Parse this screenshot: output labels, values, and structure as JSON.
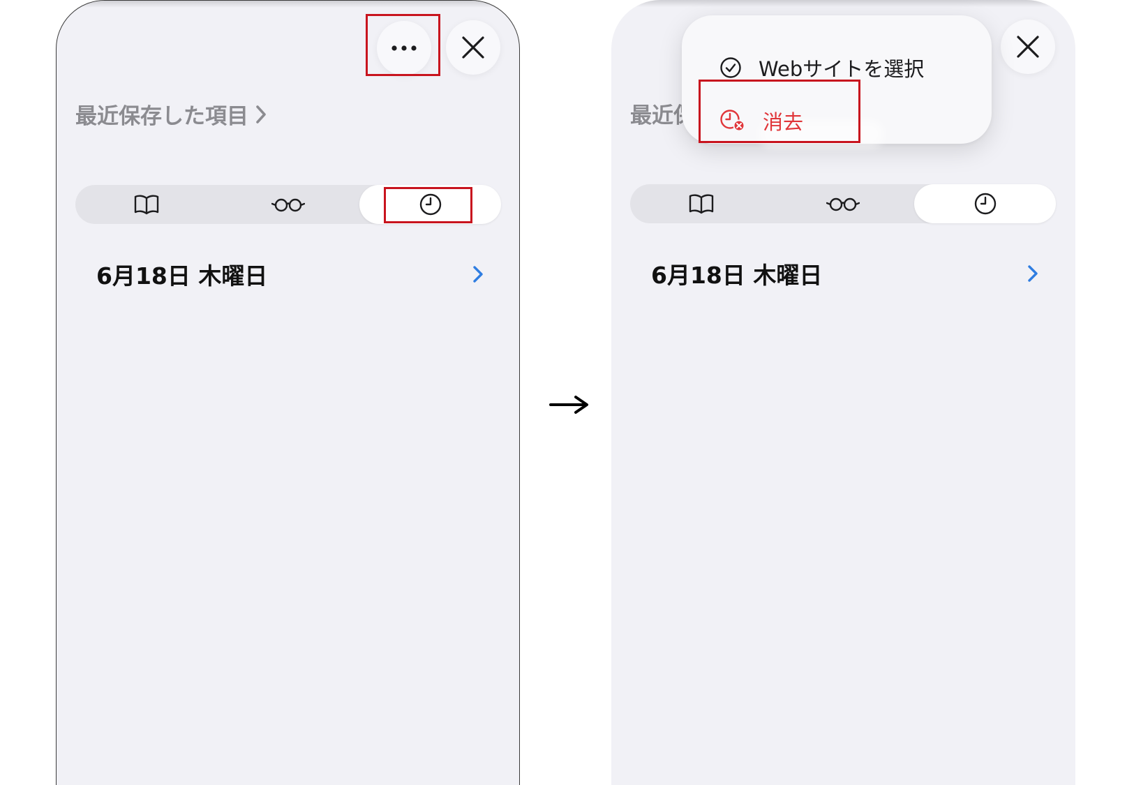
{
  "left": {
    "section_title": "最近保存した項目",
    "date_row": "6月18日 木曜日"
  },
  "right": {
    "section_title_partial": "最近保",
    "date_row": "6月18日 木曜日",
    "menu": {
      "select_label": "Webサイトを選択",
      "clear_label": "消去"
    }
  },
  "transition_arrow": "→",
  "colors": {
    "sheet_bg": "#f1f1f6",
    "accent_blue": "#2f7de1",
    "destructive_red": "#e0363a",
    "highlight_box": "#c8141e",
    "secondary_text": "#8b8b90"
  },
  "icons": {
    "more": "ellipsis-icon",
    "close": "xmark-icon",
    "bookmarks": "open-book-icon",
    "reading_list": "eyeglasses-icon",
    "history": "clock-icon",
    "chevron": "chevron-right-icon",
    "select": "checkmark-circle-icon",
    "clear": "clock-xmark-icon"
  },
  "annotations": {
    "left_highlighted": [
      "more-button",
      "history-tab"
    ],
    "right_highlighted": [
      "clear-menu-item"
    ]
  }
}
